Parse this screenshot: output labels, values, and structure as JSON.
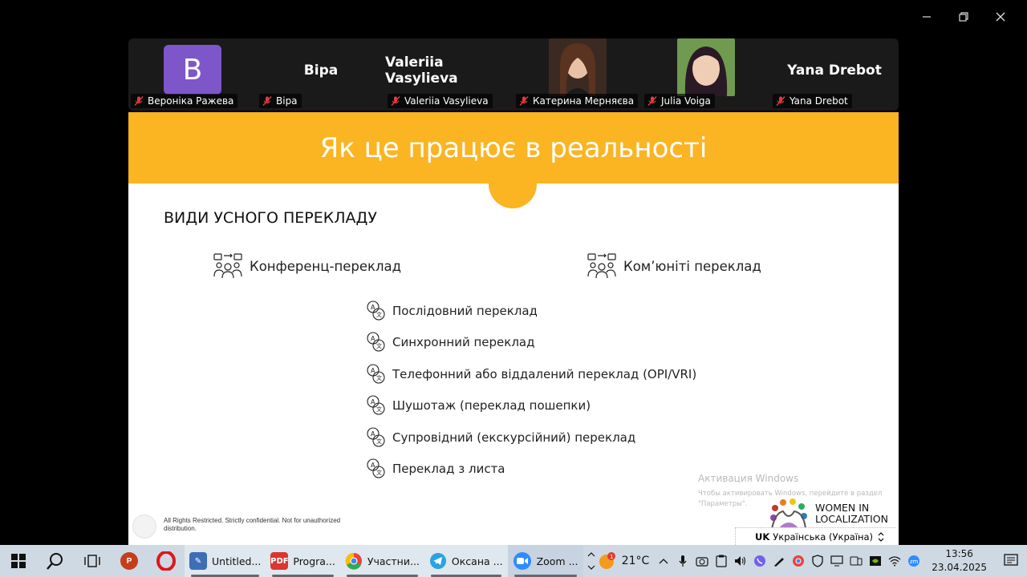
{
  "gallery": {
    "tiles": [
      {
        "type": "avatar",
        "initial": "B",
        "label": "Вероніка Ражева"
      },
      {
        "type": "name",
        "display_name": "Віра",
        "label": "Віра"
      },
      {
        "type": "name",
        "display_name": "Valeriia Vasylieva",
        "label": "Valeriia Vasylieva"
      },
      {
        "type": "photo",
        "label": "Катерина Мерняєва"
      },
      {
        "type": "photo",
        "label": "Julia Voiga"
      },
      {
        "type": "name",
        "display_name": "Yana Drebot",
        "label": "Yana Drebot"
      }
    ]
  },
  "slide": {
    "title": "Як це працює в реальності",
    "section_title": "ВИДИ УСНОГО ПЕРЕКЛАДУ",
    "categories": [
      "Конференц-переклад",
      "Ком’юніті переклад"
    ],
    "items": [
      "Послідовний переклад",
      "Синхронний переклад",
      "Телефонний або віддалений переклад (OPI/VRI)",
      "Шушотаж (переклад пошепки)",
      "Супровідний (екскурсійний) переклад",
      "Переклад з листа"
    ],
    "footer": "All Rights Restricted. Strictly confidential. Not for unauthorized distribution.",
    "logo_line1": "WOMEN IN",
    "logo_line2": "LOCALIZATION",
    "brand_color": "#fbb422"
  },
  "activation": {
    "title": "Активация Windows",
    "line1": "Чтобы активировать Windows, перейдите в раздел",
    "line2": "\"Параметры\"."
  },
  "language_bar": {
    "code": "UK",
    "name": "Українська (Україна)"
  },
  "taskbar": {
    "apps": [
      {
        "label": "Untitled...",
        "icon": "paint-icon"
      },
      {
        "label": "Progra...",
        "icon": "pdf-icon"
      },
      {
        "label": "Участни...",
        "icon": "chrome-icon"
      },
      {
        "label": "Оксана ...",
        "icon": "telegram-icon"
      },
      {
        "label": "Zoom ...",
        "icon": "zoom-icon"
      }
    ],
    "weather": "21°C",
    "weather_badge": "1",
    "time": "13:56",
    "date": "23.04.2025"
  }
}
